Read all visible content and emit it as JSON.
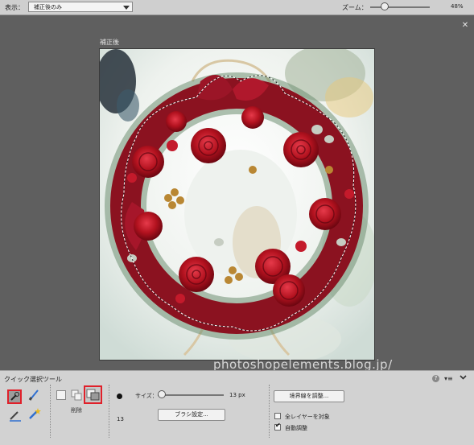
{
  "topbar": {
    "view_label": "表示：",
    "view_value": "補正後のみ",
    "zoom_label": "ズーム：",
    "zoom_value": "48%"
  },
  "canvas": {
    "after_label": "補正後",
    "watermark": "photoshopelements.blog.jp/"
  },
  "options": {
    "tool_name": "クイック選択ツール",
    "mode_label": "削除",
    "brush_number": "13",
    "size_label": "サイズ：",
    "size_value": "13 px",
    "brush_settings": "ブラシ設定...",
    "refine_edge": "境界線を調整...",
    "sample_all_layers": "全レイヤーを対象",
    "auto_enhance": "自動調整",
    "auto_enhance_checked": true,
    "sample_all_layers_checked": false
  },
  "colors": {
    "highlight_border": "#e0202a",
    "canvas_bg": "#5f5f5f",
    "panel_bg": "#d2d2d2"
  },
  "icons": [
    "quick-selection-icon",
    "selection-brush-icon",
    "smart-brush-icon",
    "magic-wand-icon",
    "new-selection-icon",
    "add-selection-icon",
    "subtract-selection-icon",
    "help-icon",
    "panel-menu-icon",
    "collapse-icon",
    "close-icon"
  ]
}
